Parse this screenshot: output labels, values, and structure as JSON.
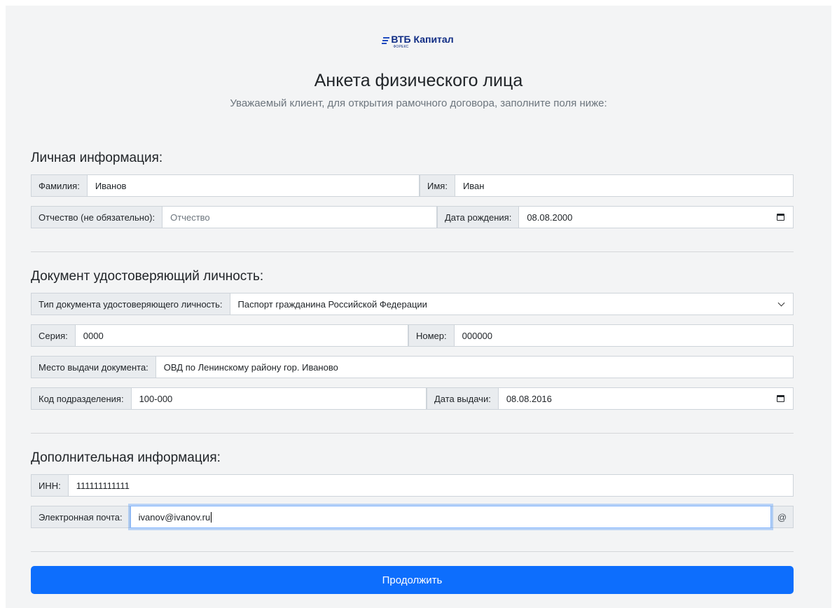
{
  "logo": {
    "name": "ВТБ Капитал",
    "sub": "ФОРЕКС"
  },
  "title": "Анкета физического лица",
  "subtitle": "Уважаемый клиент, для открытия рамочного договора, заполните поля ниже:",
  "personal": {
    "heading": "Личная информация:",
    "surname_label": "Фамилия:",
    "surname_value": "Иванов",
    "name_label": "Имя:",
    "name_value": "Иван",
    "patronymic_label": "Отчество (не обязательно):",
    "patronymic_placeholder": "Отчество",
    "birthdate_label": "Дата рождения:",
    "birthdate_value": "08.08.2000"
  },
  "document": {
    "heading": "Документ удостоверяющий личность:",
    "type_label": "Тип документа удостоверяющего личность:",
    "type_value": "Паспорт гражданина Российской Федерации",
    "series_label": "Серия:",
    "series_value": "0000",
    "number_label": "Номер:",
    "number_value": "000000",
    "place_label": "Место выдачи документа:",
    "place_value": "ОВД по Ленинскому району гор. Иваново",
    "code_label": "Код подразделения:",
    "code_value": "100-000",
    "issue_date_label": "Дата выдачи:",
    "issue_date_value": "08.08.2016"
  },
  "additional": {
    "heading": "Дополнительная информация:",
    "inn_label": "ИНН:",
    "inn_value": "111111111111",
    "email_label": "Электронная почта:",
    "email_value": "ivanov@ivanov.ru",
    "email_append": "@"
  },
  "submit_label": "Продолжить",
  "colors": {
    "primary": "#0d6efd",
    "background": "#f3f4f5",
    "label_bg": "#e9ecef",
    "brand": "#0f2c84"
  }
}
